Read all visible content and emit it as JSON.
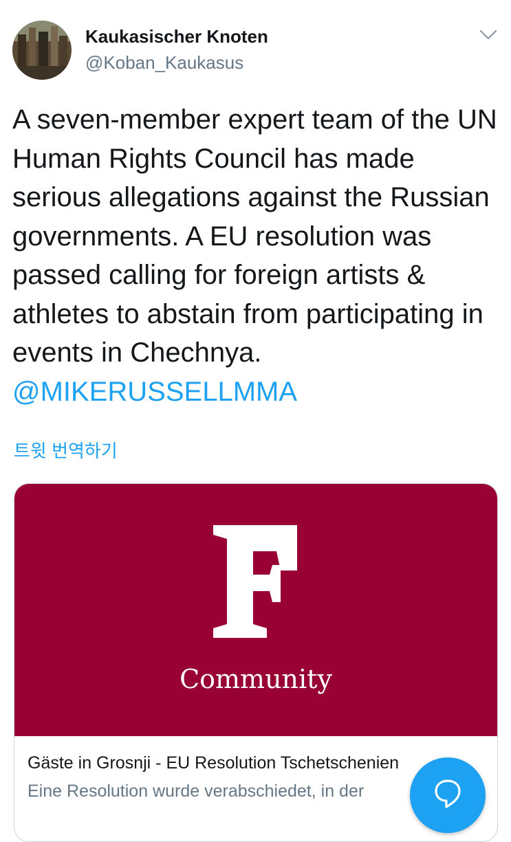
{
  "author": {
    "name": "Kaukasischer Knoten",
    "handle": "@Koban_Kaukasus",
    "avatar_icon": "avatar-image"
  },
  "tweet": {
    "text": "A seven-member expert team of the UN Human Rights Council has made serious allegations against the Russian governments. A EU resolution was passed calling for foreign artists & athletes to abstain from participating in events in Chechnya.",
    "mention": "@MIKERUSSELLMMA",
    "translate_label": "트윗 번역하기"
  },
  "card": {
    "logo_letter": "F",
    "logo_word": "Community",
    "title": "Gäste in Grosnji - EU Resolution Tschetschenien",
    "description": "Eine Resolution wurde verabschiedet, in der",
    "background_color": "#990033"
  },
  "icons": {
    "menu": "chevron-down-icon",
    "compose": "compose-icon"
  },
  "colors": {
    "accent": "#1da1f2",
    "secondary_text": "#657786",
    "primary_text": "#14171a"
  }
}
